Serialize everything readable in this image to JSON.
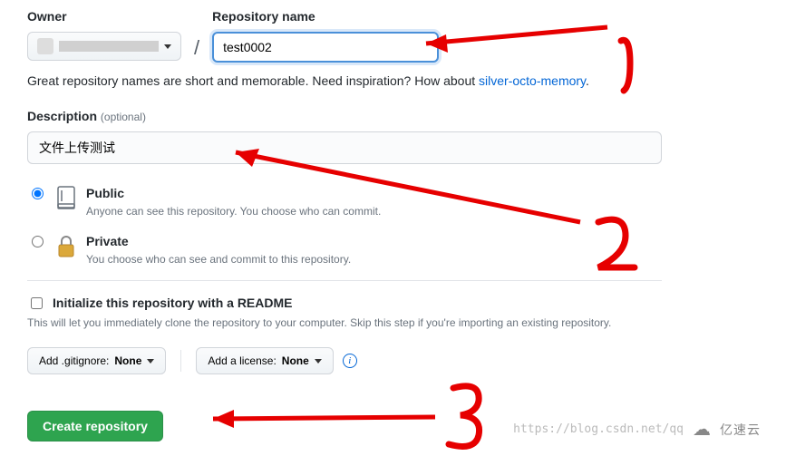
{
  "owner": {
    "label": "Owner"
  },
  "repo": {
    "label": "Repository name",
    "value": "test0002"
  },
  "hint": {
    "prefix": "Great repository names are short and memorable. Need inspiration? How about ",
    "suggestion": "silver-octo-memory",
    "suffix": "."
  },
  "description": {
    "label": "Description",
    "optional": "(optional)",
    "value": "文件上传测试"
  },
  "visibility": {
    "public": {
      "title": "Public",
      "desc": "Anyone can see this repository. You choose who can commit."
    },
    "private": {
      "title": "Private",
      "desc": "You choose who can see and commit to this repository."
    }
  },
  "readme": {
    "title": "Initialize this repository with a README",
    "desc": "This will let you immediately clone the repository to your computer. Skip this step if you're importing an existing repository."
  },
  "dropdowns": {
    "gitignore_prefix": "Add .gitignore: ",
    "gitignore_value": "None",
    "license_prefix": "Add a license: ",
    "license_value": "None"
  },
  "create_label": "Create repository",
  "watermark": {
    "url": "https://blog.csdn.net/qq",
    "brand": "亿速云"
  },
  "annotations": {
    "n1": "1",
    "n2": "2",
    "n3": "3"
  }
}
